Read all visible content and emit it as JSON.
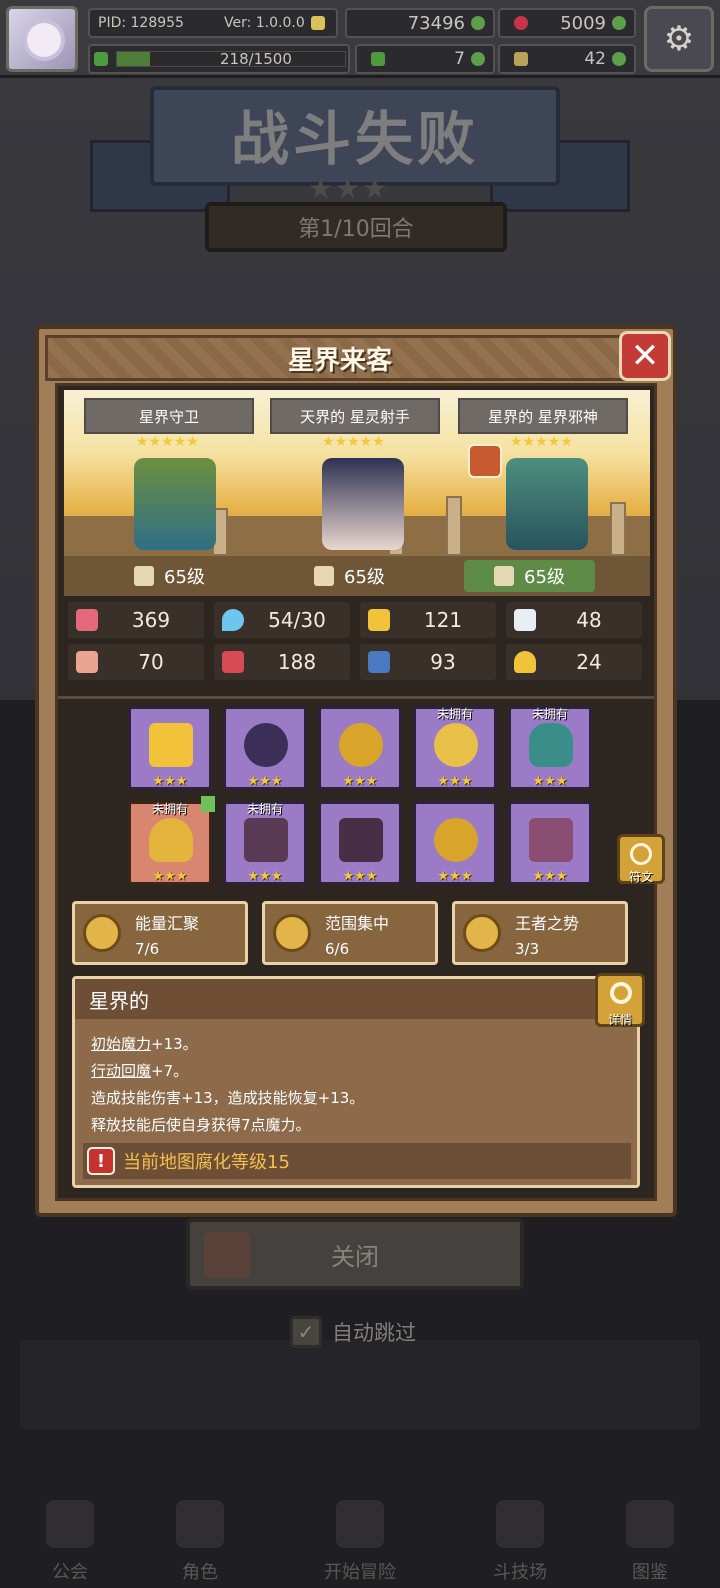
{
  "hud": {
    "pid": "PID: 128955",
    "version": "Ver: 1.0.0.0",
    "currency1": "73496",
    "currency2": "5009",
    "exp": "218/1500",
    "exp_fraction": 0.145,
    "currency3": "7",
    "currency4": "42"
  },
  "result": {
    "title": "战斗失败",
    "round": "第1/10回合"
  },
  "dialog": {
    "title": "星界来客",
    "heroes": [
      {
        "name": "星界守卫",
        "stars": "★★★★★",
        "level": "65级",
        "icon": "sword-icon"
      },
      {
        "name": "天界的 星灵射手",
        "stars": "★★★★★",
        "level": "65级",
        "icon": "book-icon"
      },
      {
        "name": "星界的 星界邪神",
        "stars": "★★★★★",
        "level": "65级",
        "icon": "staff-icon"
      }
    ],
    "stats": [
      {
        "icon": "heart-icon",
        "value": "369",
        "color": "#e46a7a"
      },
      {
        "icon": "mana-drop-icon",
        "value": "54/30",
        "color": "#6cc6ee"
      },
      {
        "icon": "shield-icon",
        "value": "121",
        "color": "#f2c23b"
      },
      {
        "icon": "wing-icon",
        "value": "48",
        "color": "#e9eef5"
      },
      {
        "icon": "fist-icon",
        "value": "70",
        "color": "#e7a592"
      },
      {
        "icon": "spellbook-icon",
        "value": "188",
        "color": "#d84a55"
      },
      {
        "icon": "magic-shield-icon",
        "value": "93",
        "color": "#4a78c2"
      },
      {
        "icon": "horseshoe-icon",
        "value": "24",
        "color": "#f2c23b"
      }
    ],
    "equipment": [
      {
        "name": "staff",
        "stars": "★★★",
        "owned_label": "",
        "color": "#f2c23b"
      },
      {
        "name": "orb",
        "stars": "★★★",
        "owned_label": "",
        "color": "#3b2f58"
      },
      {
        "name": "necklace",
        "stars": "★★★",
        "owned_label": "",
        "color": "#d8a52a"
      },
      {
        "name": "emblem",
        "stars": "★★★",
        "owned_label": "未拥有",
        "color": "#e9c04a"
      },
      {
        "name": "ring",
        "stars": "★★★",
        "owned_label": "未拥有",
        "color": "#3a8e8a"
      },
      {
        "name": "hat",
        "stars": "★★★",
        "owned_label": "未拥有",
        "color": "#e4b53c"
      },
      {
        "name": "robe",
        "stars": "★★★",
        "owned_label": "未拥有",
        "color": "#5a3a55"
      },
      {
        "name": "glove",
        "stars": "★★★",
        "owned_label": "",
        "color": "#4a2e45"
      },
      {
        "name": "bracelet",
        "stars": "★★★",
        "owned_label": "",
        "color": "#d8a52a"
      },
      {
        "name": "boots",
        "stars": "★★★",
        "owned_label": "",
        "color": "#8a4e73"
      }
    ],
    "rune_label": "符文",
    "sets": [
      {
        "name": "能量汇聚",
        "progress": "7/6"
      },
      {
        "name": "范围集中",
        "progress": "6/6"
      },
      {
        "name": "王者之势",
        "progress": "3/3"
      }
    ],
    "description": {
      "title": "星界的",
      "detail_label": "详情",
      "line1_key": "初始魔力",
      "line1_val": "+13。",
      "line2_key": "行动回魔",
      "line2_val": "+7。",
      "line3": "造成技能伤害+13，造成技能恢复+13。",
      "line4": "释放技能后使自身获得7点魔力。",
      "warning": "当前地图腐化等级15"
    }
  },
  "bottom": {
    "close_label": "关闭",
    "auto_skip": "自动跳过",
    "nav": [
      "公会",
      "角色",
      "开始冒险",
      "斗技场",
      "图鉴"
    ]
  }
}
